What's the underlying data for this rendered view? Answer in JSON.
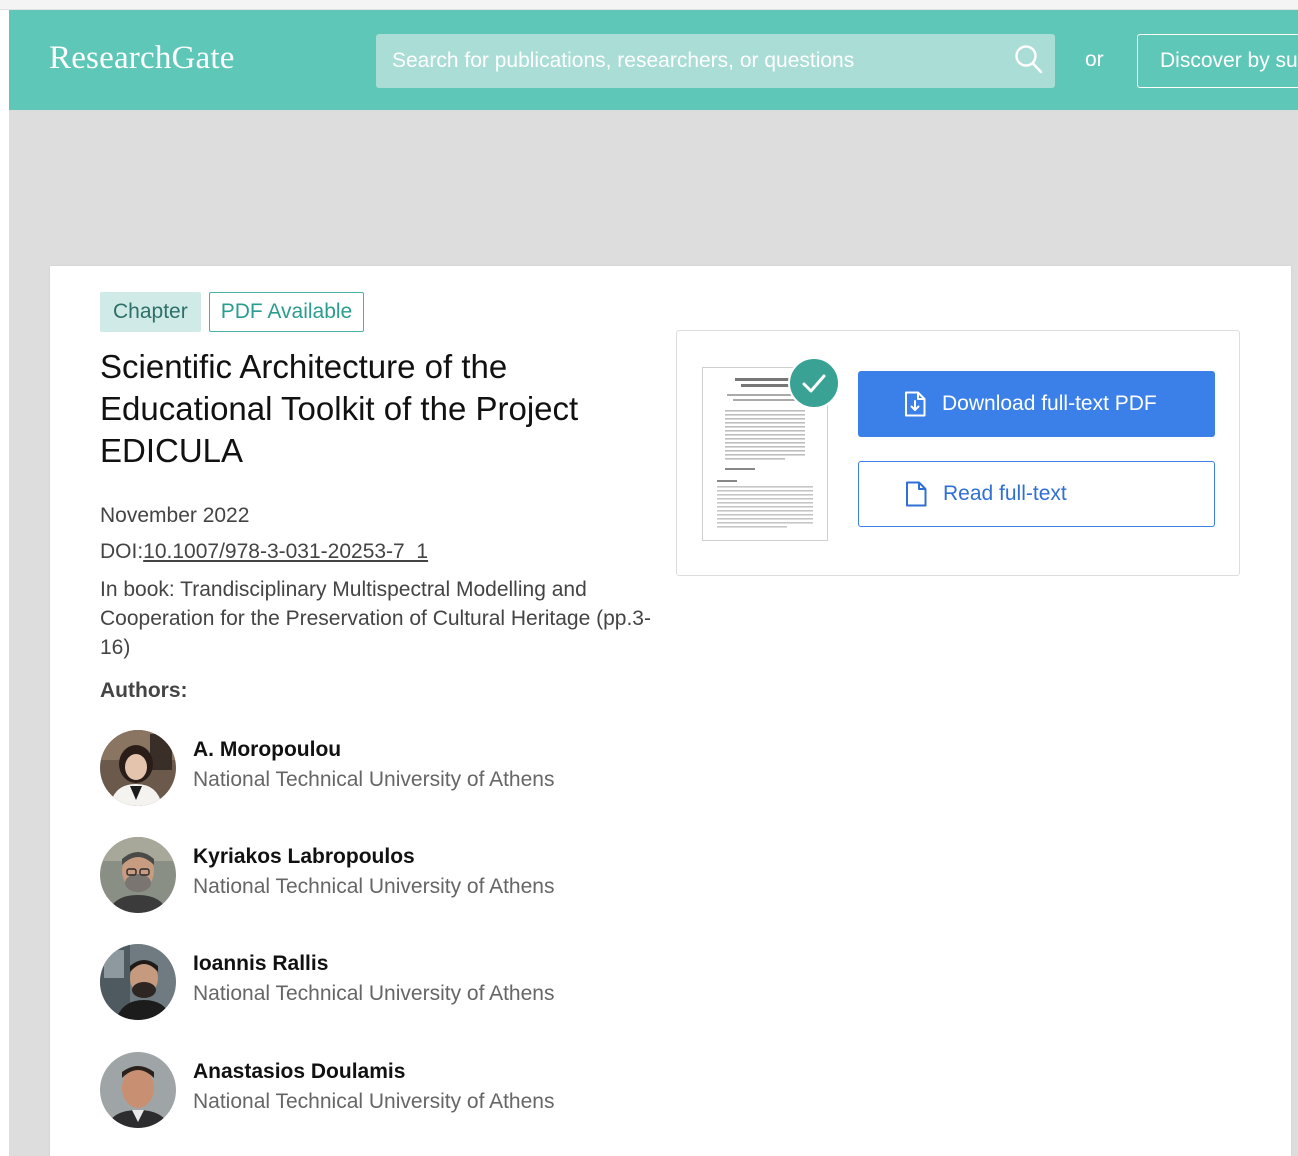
{
  "header": {
    "logo": "ResearchGate",
    "search_placeholder": "Search for publications, researchers, or questions",
    "or_label": "or",
    "discover_label": "Discover by subject area"
  },
  "publication": {
    "tags": [
      "Chapter",
      "PDF Available"
    ],
    "title": "Scientific Architecture of the Educational Toolkit of the Project EDICULA",
    "date": "November 2022",
    "doi_prefix": "DOI:",
    "doi": "10.1007/978-3-031-20253-7_1",
    "book": "In book: Trandisciplinary Multispectral Modelling and Cooperation for the Preservation of Cultural Heritage (pp.3-16)",
    "authors_label": "Authors:",
    "authors": [
      {
        "name": "A. Moropoulou",
        "institution": "National Technical University of Athens"
      },
      {
        "name": "Kyriakos Labropoulos",
        "institution": "National Technical University of Athens"
      },
      {
        "name": "Ioannis Rallis",
        "institution": "National Technical University of Athens"
      },
      {
        "name": "Anastasios Doulamis",
        "institution": "National Technical University of Athens"
      }
    ]
  },
  "download": {
    "download_label": "Download full-text PDF",
    "read_label": "Read full-text"
  },
  "colors": {
    "header_bg": "#5fc7b8",
    "primary_blue": "#3b80e8",
    "badge_teal": "#3aa195"
  },
  "icons": [
    "search-icon",
    "check-icon",
    "pdf-download-icon",
    "document-icon"
  ]
}
